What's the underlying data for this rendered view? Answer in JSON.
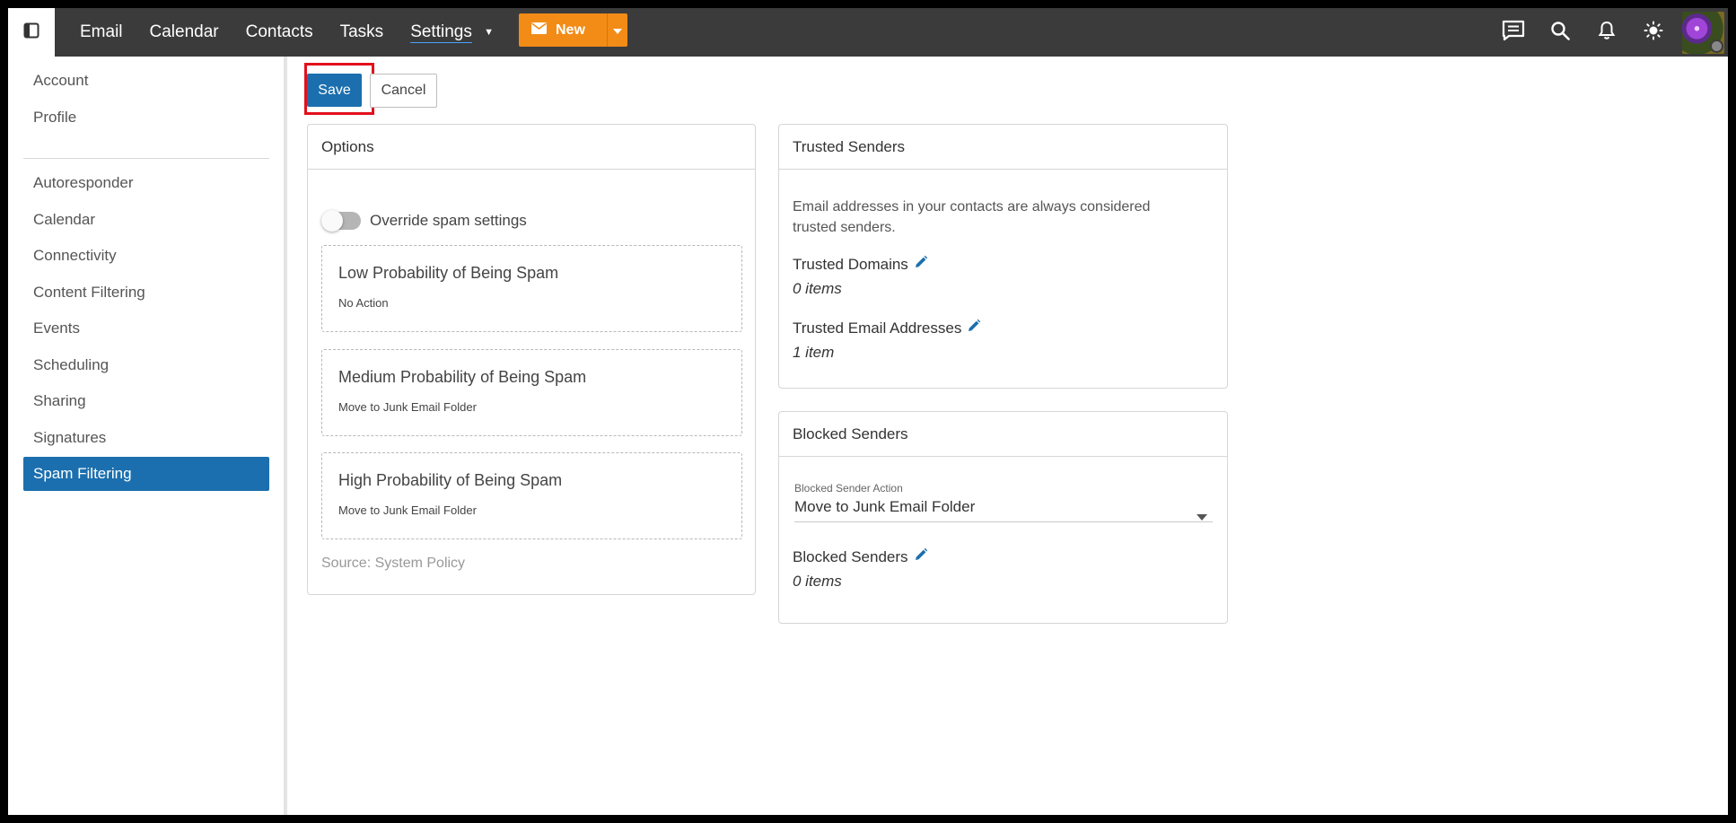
{
  "topbar": {
    "nav": [
      "Email",
      "Calendar",
      "Contacts",
      "Tasks",
      "Settings"
    ],
    "new_label": "New",
    "icons": [
      "sidebar-toggle-icon",
      "chat-icon",
      "search-icon",
      "bell-icon",
      "theme-sun-icon"
    ],
    "accent": "#f28c17"
  },
  "sidebar": {
    "items": [
      "Account",
      "Profile",
      "Autoresponder",
      "Calendar",
      "Connectivity",
      "Content Filtering",
      "Events",
      "Scheduling",
      "Sharing",
      "Signatures",
      "Spam Filtering"
    ],
    "active": "Spam Filtering",
    "active_color": "#1b6fae"
  },
  "actions": {
    "save": "Save",
    "cancel": "Cancel"
  },
  "options": {
    "title": "Options",
    "override_label": "Override spam settings",
    "override_on": false,
    "levels": [
      {
        "title": "Low Probability of Being Spam",
        "action": "No Action"
      },
      {
        "title": "Medium Probability of Being Spam",
        "action": "Move to Junk Email Folder"
      },
      {
        "title": "High Probability of Being Spam",
        "action": "Move to Junk Email Folder"
      }
    ],
    "source": "Source: System Policy"
  },
  "trusted": {
    "title": "Trusted Senders",
    "description": "Email addresses in your contacts are always considered trusted senders.",
    "domains_label": "Trusted Domains",
    "domains_count": "0 items",
    "addresses_label": "Trusted Email Addresses",
    "addresses_count": "1 item"
  },
  "blocked": {
    "title": "Blocked Senders",
    "action_label": "Blocked Sender Action",
    "action_value": "Move to Junk Email Folder",
    "senders_label": "Blocked Senders",
    "senders_count": "0 items"
  }
}
